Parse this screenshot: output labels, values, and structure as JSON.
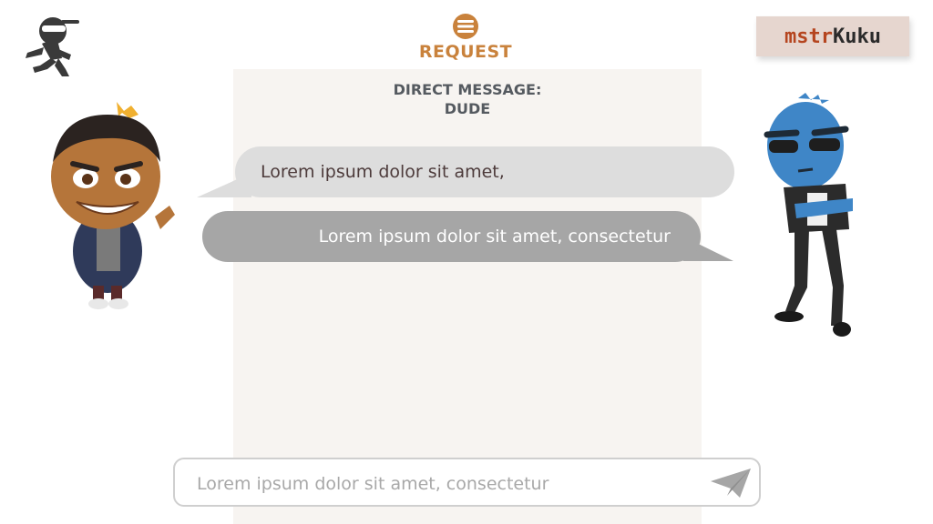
{
  "header": {
    "title": "REQUEST",
    "icon": "hamburger-circle-icon",
    "brand": {
      "part1": "mstr",
      "part2": "Kuku"
    },
    "left_logo": "running-ninja-icon"
  },
  "conversation": {
    "title_line1": "DIRECT MESSAGE:",
    "title_line2": "DUDE",
    "messages": [
      {
        "direction": "incoming",
        "text": "Lorem ipsum dolor sit amet,"
      },
      {
        "direction": "outgoing",
        "text": "Lorem ipsum dolor sit amet, consectetur"
      }
    ]
  },
  "compose": {
    "placeholder": "Lorem ipsum dolor sit amet, consectetur",
    "send_icon": "paper-plane-icon"
  },
  "colors": {
    "accent": "#c9823c",
    "panel_bg": "#f7f4f1",
    "bubble_incoming": "#dddddd",
    "bubble_outgoing": "#a6a6a6"
  }
}
